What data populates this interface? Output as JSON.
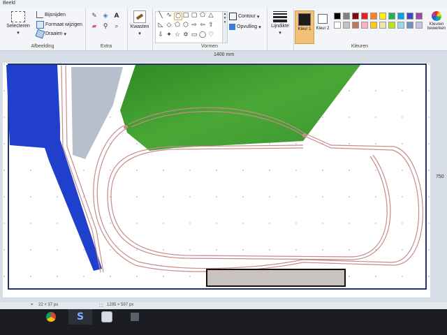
{
  "window": {
    "title": "Beeld"
  },
  "ribbon": {
    "afbeelding": {
      "select_label": "Selecteren",
      "crop_label": "Bijsnijden",
      "resize_label": "Formaat wijzigen",
      "rotate_label": "Draaien",
      "group_label": "Afbeelding"
    },
    "extra": {
      "group_label": "Extra"
    },
    "brushes": {
      "label": "Kwasten"
    },
    "vormen": {
      "outline_label": "Contour",
      "fill_label": "Opvulling",
      "group_label": "Vormen"
    },
    "line_width_label": "Lijndikte",
    "colors": {
      "color1_label": "Kleur 1",
      "color2_label": "Kleur 2",
      "color1": "#1c1c1c",
      "color2": "#ffffff",
      "edit_label": "Kleuren bewerken",
      "group_label": "Kleuren",
      "palette": [
        "#000000",
        "#7f7f7f",
        "#880015",
        "#ed1c24",
        "#ff7f27",
        "#fff200",
        "#22b14c",
        "#00a2e8",
        "#3f48cc",
        "#a349a4",
        "#ffffff",
        "#c3c3c3",
        "#b97a57",
        "#ffaec9",
        "#ffc90e",
        "#efe4b0",
        "#b5e61d",
        "#99d9ea",
        "#7092be",
        "#c8bfe7"
      ]
    }
  },
  "canvas": {
    "width_ruler": "1400 mm",
    "height_ruler": "750",
    "colors": {
      "blue": "#1f3fcc",
      "green": "#3e9a2c",
      "gray": "#b8bfcc",
      "track": "#c98a8a"
    }
  },
  "status": {
    "cursor_pos": "22 × 37 px",
    "selection_size": "1295 × 597 px"
  },
  "taskbar": {
    "skype_label": "S"
  }
}
